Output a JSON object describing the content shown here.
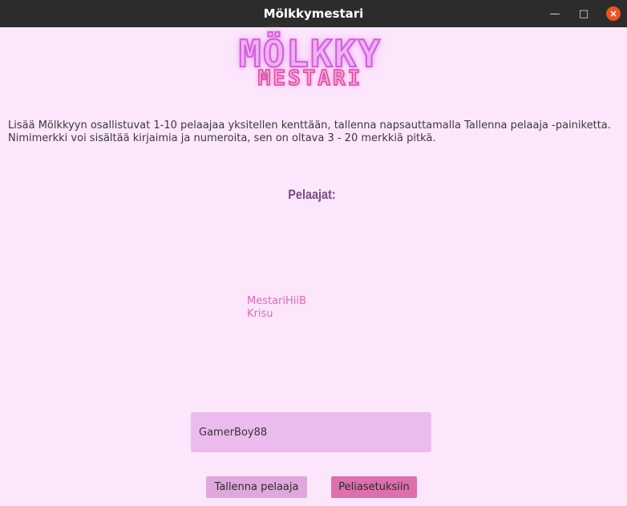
{
  "window": {
    "title": "Mölkkymestari",
    "controls": [
      "minimize-icon",
      "maximize-icon",
      "close-icon"
    ]
  },
  "logo": {
    "line1": "MÖLKKY",
    "line2": "MESTARI"
  },
  "instructions": {
    "line1": "Lisää Mölkkyyn osallistuvat 1-10 pelaajaa yksitellen kenttään, tallenna napsauttamalla Tallenna pelaaja -painiketta.",
    "line2": "Nimimerkki voi sisältää kirjaimia ja numeroita, sen on oltava 3 - 20 merkkiä pitkä."
  },
  "players": {
    "heading": "Pelaajat:",
    "list": [
      "MestariHiiB",
      "Krisu"
    ]
  },
  "name_input": {
    "value": "GamerBoy88"
  },
  "buttons": {
    "save_label": "Tallenna pelaaja",
    "settings_label": "Peliasetuksiin"
  },
  "colors": {
    "background": "#fbe6fc",
    "titlebar": "#2c2c2c",
    "heading": "#7a4c86",
    "player_text": "#e06ab2",
    "input_bg": "#ecbbee",
    "save_button": "#dfa8dc",
    "settings_button": "#dc6fac",
    "close_button": "#e95420"
  }
}
